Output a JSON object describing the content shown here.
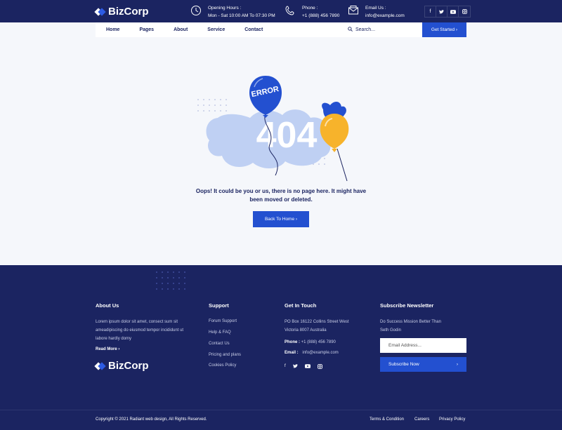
{
  "brand": {
    "name": "BizCorp"
  },
  "topbar": {
    "hours_label": "Opening Hours :",
    "hours_value": "Mon - Sat 10:00 AM To 07:30 PM",
    "phone_label": "Phone :",
    "phone_value": "+1 (888) 456 7890",
    "email_label": "Email Us :",
    "email_value": "info@example.com",
    "social": [
      "f",
      "t",
      "yt",
      "ig"
    ]
  },
  "nav": {
    "items": [
      "Home",
      "Pages",
      "About",
      "Service",
      "Contact"
    ],
    "search_placeholder": "Search...",
    "cta": "Get Started ›"
  },
  "error": {
    "code": "404",
    "balloon_text": "ERROR",
    "message": "Oops! It could be you or us, there is no page here. It might have been moved or deleted.",
    "button": "Back To Home ›"
  },
  "footer": {
    "about": {
      "title": "About Us",
      "text": "Lorem ipsum dolor sit amet, consect sum sit ameadipiscing do eiusmod tempor incididunt ut labore hardly domy",
      "read_more": "Read More ›"
    },
    "support": {
      "title": "Support",
      "links": [
        "Forum Support",
        "Help & FAQ",
        "Contact Us",
        "Pricing and plans",
        "Cookies Policy"
      ]
    },
    "contact": {
      "title": "Get In Touch",
      "address": "PO Box 16122 Collins Street West Victoria 8007 Australia",
      "phone_label": "Phone :",
      "phone": "+1 (888) 456 7890",
      "email_label": "Email :",
      "email": "info@example.com"
    },
    "newsletter": {
      "title": "Subscribe Newsletter",
      "text": "Do Success Mission Better Than Seth Godin",
      "placeholder": "Email Address...",
      "button": "Subscribe Now",
      "button_arrow": "›"
    },
    "copyright": "Copyright © 2021 Radiant web design, All Rights Reserved.",
    "legal": [
      "Terms & Condition",
      "Careers",
      "Privacy Policy"
    ]
  },
  "colors": {
    "navy": "#1b2461",
    "accent": "#2350d0",
    "balloon_yellow": "#f7b32b"
  }
}
